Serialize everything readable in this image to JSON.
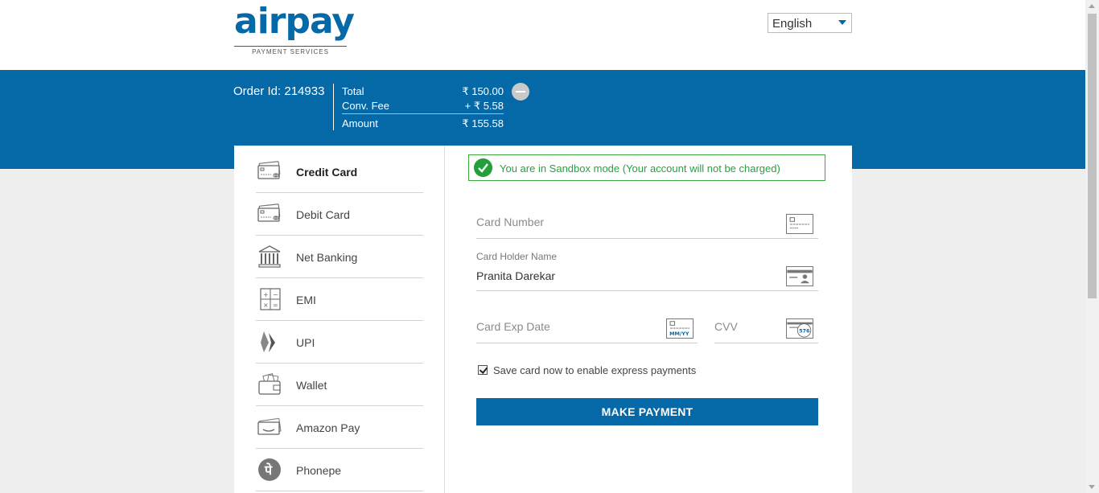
{
  "brand": {
    "name": "airpay",
    "tagline": "PAYMENT SERVICES",
    "color": "#0569a8"
  },
  "language": {
    "selected": "English"
  },
  "order": {
    "id_label": "Order Id: 214933",
    "total_label": "Total",
    "total_value": "₹ 150.00",
    "fee_label": "Conv. Fee",
    "fee_value": "+ ₹ 5.58",
    "amount_label": "Amount",
    "amount_value": "₹ 155.58"
  },
  "methods": [
    {
      "label": "Credit Card",
      "icon": "credit-card-icon",
      "active": true
    },
    {
      "label": "Debit Card",
      "icon": "debit-card-icon",
      "active": false
    },
    {
      "label": "Net Banking",
      "icon": "bank-icon",
      "active": false
    },
    {
      "label": "EMI",
      "icon": "calculator-icon",
      "active": false
    },
    {
      "label": "UPI",
      "icon": "upi-icon",
      "active": false
    },
    {
      "label": "Wallet",
      "icon": "wallet-icon",
      "active": false
    },
    {
      "label": "Amazon Pay",
      "icon": "amazon-pay-icon",
      "active": false
    },
    {
      "label": "Phonepe",
      "icon": "phonepe-icon",
      "active": false
    }
  ],
  "sandbox": {
    "message": "You are in Sandbox mode (Your account will not be charged)",
    "color": "#27a045"
  },
  "form": {
    "card_number": {
      "placeholder": "Card Number",
      "value": ""
    },
    "card_holder": {
      "label": "Card Holder Name",
      "value": "Pranita Darekar"
    },
    "exp_date": {
      "placeholder": "Card Exp Date",
      "icon_text": "MM/YY"
    },
    "cvv": {
      "placeholder": "CVV",
      "icon_text": "576"
    },
    "save_card": {
      "label": "Save card now to enable express payments",
      "checked": true
    },
    "submit_label": "MAKE PAYMENT"
  }
}
